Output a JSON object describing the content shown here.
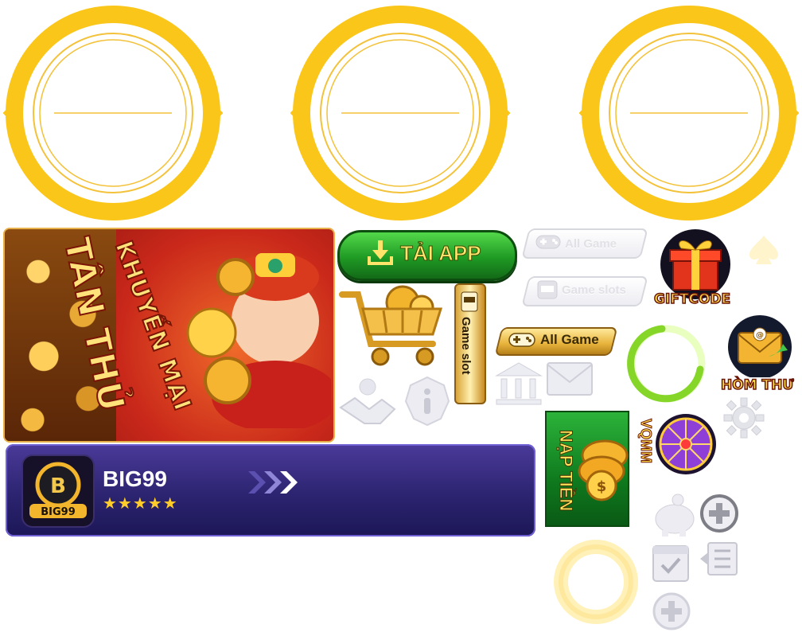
{
  "download_button": {
    "label": "TẢI APP"
  },
  "profile_card": {
    "name": "BIG99",
    "stars": "★★★★★",
    "logo_text": "BIG99"
  },
  "promo_banner": {
    "line1": "KHUYẾN MẠI",
    "line2": "TÂN THỦ"
  },
  "tabs": {
    "all_game_inactive": "All Game",
    "game_slots_inactive": "Game slots",
    "all_game_active": "All Game",
    "game_slot_vertical": "Game slot"
  },
  "badges": {
    "giftcode": "GIFTCODE",
    "hom_thu": "HÒM THƯ",
    "vqmm": "VQMM",
    "nap_tien": "NẠP TIỀN"
  },
  "icons": [
    "gold-ring-frame",
    "download-icon",
    "gamepad-icon",
    "slot-machine-icon",
    "gift-box-icon",
    "spade-icon",
    "shopping-cart-icon",
    "handshake-icon",
    "info-icon",
    "bank-icon",
    "mail-icon",
    "loading-ring-icon",
    "mail-envelope-icon",
    "gear-icon",
    "lucky-wheel-icon",
    "coin-stack-icon",
    "piggy-bank-icon",
    "plus-circle-icon",
    "calendar-check-icon",
    "list-back-icon",
    "glow-ring-icon"
  ],
  "colors": {
    "gold": "#fbc61a",
    "card_purple": "#2c2470",
    "app_green": "#1f9a24",
    "stars": "#ffcc2a"
  }
}
